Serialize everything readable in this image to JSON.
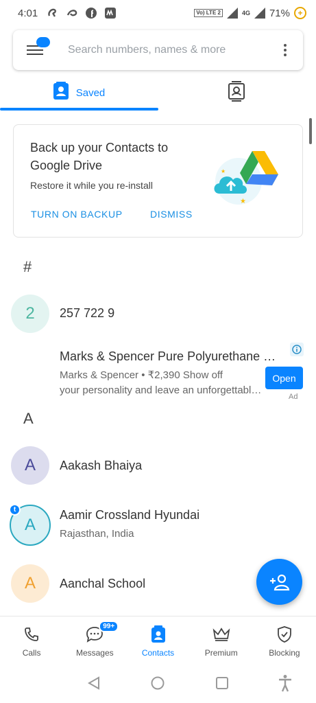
{
  "status_bar": {
    "time": "4:01",
    "battery": "71%",
    "network": "4G",
    "volte": "Vo) LTE 2"
  },
  "search": {
    "placeholder": "Search numbers, names & more"
  },
  "tabs": [
    {
      "label": "Saved",
      "icon": "contact-card-icon",
      "active": true
    },
    {
      "label": "",
      "icon": "contact-book-icon",
      "active": false
    }
  ],
  "backup_card": {
    "title": "Back up your Contacts to Google Drive",
    "subtitle": "Restore it while you re-install",
    "primary_action": "TURN ON BACKUP",
    "secondary_action": "DISMISS"
  },
  "sections": {
    "hash": "#",
    "a": "A"
  },
  "contacts": [
    {
      "initial": "2",
      "name": "257 722 9",
      "subtitle": "",
      "avatar_bg": "#e3f4f1",
      "avatar_fg": "#4db6a0"
    },
    {
      "initial": "A",
      "name": "Aakash Bhaiya",
      "subtitle": "",
      "avatar_bg": "#dcdcee",
      "avatar_fg": "#4b4b9a"
    },
    {
      "initial": "A",
      "name": "Aamir Crossland Hyundai",
      "subtitle": "Rajasthan, India",
      "avatar_bg": "#d9f1f5",
      "avatar_fg": "#2aa8c0",
      "badge": "t"
    },
    {
      "initial": "A",
      "name": "Aanchal School",
      "subtitle": "",
      "avatar_bg": "#fdebd3",
      "avatar_fg": "#f0a030"
    }
  ],
  "ad": {
    "title": "Marks & Spencer Pure Polyurethane Leather...",
    "line1": "Marks & Spencer • ₹2,390 Show off",
    "line2": "your personality and leave an unforgettable...",
    "cta": "Open",
    "tag": "Ad"
  },
  "bottom_nav": [
    {
      "label": "Calls",
      "icon": "phone-icon",
      "active": false
    },
    {
      "label": "Messages",
      "icon": "message-icon",
      "active": false,
      "badge": "99+"
    },
    {
      "label": "Contacts",
      "icon": "contacts-icon",
      "active": true
    },
    {
      "label": "Premium",
      "icon": "crown-icon",
      "active": false
    },
    {
      "label": "Blocking",
      "icon": "shield-check-icon",
      "active": false
    }
  ],
  "colors": {
    "accent": "#0a84ff",
    "link": "#1a8fe3"
  }
}
